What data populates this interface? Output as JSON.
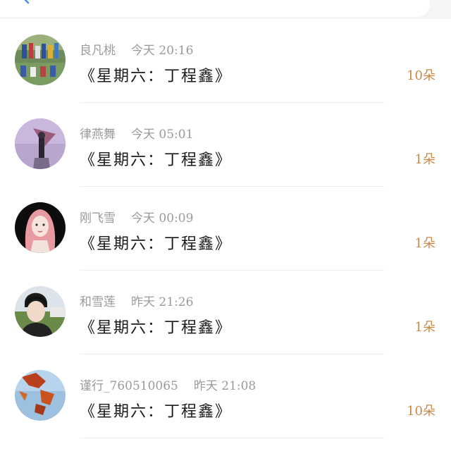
{
  "colors": {
    "accent": "#c88a4a",
    "meta_text": "#9a9a9a",
    "title_text": "#1a1a1a"
  },
  "header": {
    "icon": "back-icon"
  },
  "items": [
    {
      "user": "良凡桃",
      "time": "今天 20:16",
      "title": "《星期六：丁程鑫》",
      "count": "10朵",
      "avatar": "group-photo-avatar"
    },
    {
      "user": "律燕舞",
      "time": "今天 05:01",
      "title": "《星期六：丁程鑫》",
      "count": "1朵",
      "avatar": "umbrella-figure-avatar"
    },
    {
      "user": "刚飞雪",
      "time": "今天 00:09",
      "title": "《星期六：丁程鑫》",
      "count": "1朵",
      "avatar": "pink-hair-illustration-avatar"
    },
    {
      "user": "和雪莲",
      "time": "昨天 21:26",
      "title": "《星期六：丁程鑫》",
      "count": "1朵",
      "avatar": "boy-portrait-avatar"
    },
    {
      "user": "谨行_760510065",
      "time": "昨天 21:08",
      "title": "《星期六：丁程鑫》",
      "count": "10朵",
      "avatar": "autumn-leaves-avatar"
    }
  ]
}
